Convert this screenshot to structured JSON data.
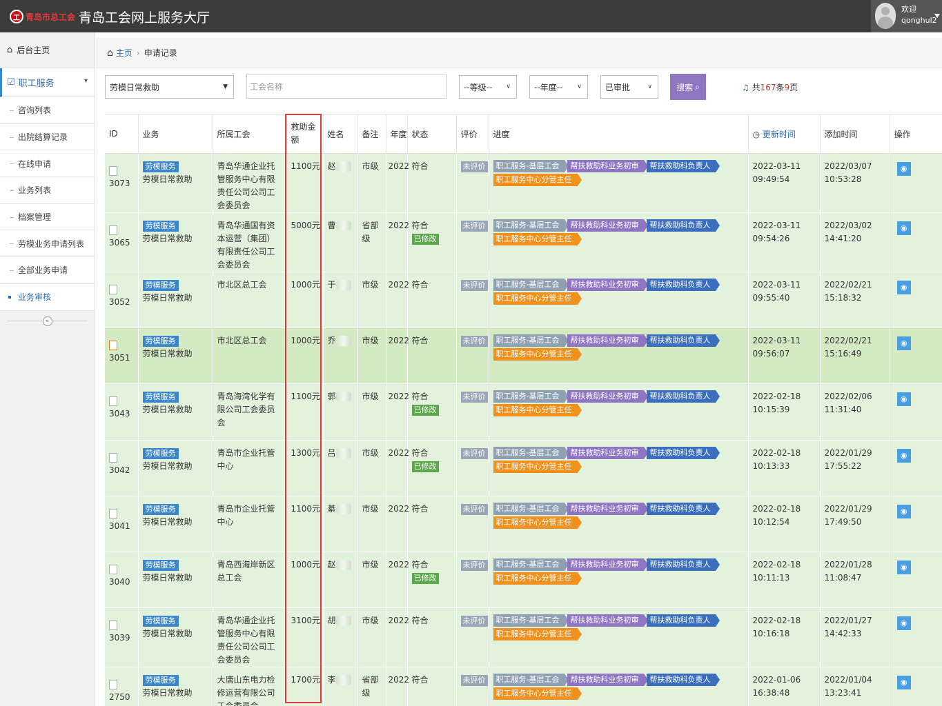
{
  "header": {
    "logo_text": "青岛市总工会",
    "title": "青岛工会网上服务大厅",
    "welcome": "欢迎",
    "username": "qonghul2"
  },
  "sidebar": {
    "home": "后台主页",
    "service": "职工服务",
    "items": [
      "咨询列表",
      "出院结算记录",
      "在线申请",
      "业务列表",
      "档案管理",
      "劳模业务申请列表",
      "全部业务申请",
      "业务审核"
    ]
  },
  "breadcrumb": {
    "home": "主页",
    "current": "申请记录"
  },
  "filters": {
    "business_type": "劳模日常救助",
    "union_placeholder": "工会名称",
    "level": "--等级--",
    "year": "--年度--",
    "status": "已审批",
    "search_label": "搜索",
    "total_prefix": "共",
    "total_count": "167",
    "total_mid": "条",
    "total_pages": "9",
    "total_suffix": "页"
  },
  "table": {
    "headers": {
      "id": "ID",
      "business": "业务",
      "union": "所属工会",
      "amount": "救助金额",
      "name": "姓名",
      "remark": "备注",
      "year": "年度",
      "status": "状态",
      "eval": "评价",
      "progress": "进度",
      "updated": "更新时间",
      "added": "添加时间",
      "action": "操作"
    },
    "tag_label": "劳模服务",
    "business_label": "劳模日常救助",
    "eval_label": "未评价",
    "modified_label": "已修改",
    "steps": [
      "职工服务-基层工会",
      "帮扶救助科业务初审",
      "帮扶救助科负责人",
      "职工服务中心分管主任"
    ],
    "rows": [
      {
        "id": "3073",
        "union": "青岛华通企业托管服务中心有限责任公司公司工会委员会",
        "amount": "1100元",
        "name": "赵",
        "remark": "市级",
        "year": "2022",
        "status": "符合",
        "modified": false,
        "updated_date": "2022-03-11",
        "updated_time": "09:49:54",
        "added_date": "2022/03/07",
        "added_time": "10:53:28"
      },
      {
        "id": "3065",
        "union": "青岛华通国有资本运营（集团）有限责任公司工会委员会",
        "amount": "5000元",
        "name": "曹",
        "remark": "省部级",
        "year": "2022",
        "status": "符合",
        "modified": true,
        "updated_date": "2022-03-11",
        "updated_time": "09:54:26",
        "added_date": "2022/03/02",
        "added_time": "14:41:20"
      },
      {
        "id": "3052",
        "union": "市北区总工会",
        "amount": "1000元",
        "name": "于",
        "remark": "市级",
        "year": "2022",
        "status": "符合",
        "modified": false,
        "updated_date": "2022-03-11",
        "updated_time": "09:55:40",
        "added_date": "2022/02/21",
        "added_time": "15:18:32"
      },
      {
        "id": "3051",
        "union": "市北区总工会",
        "amount": "1000元",
        "name": "乔",
        "remark": "市级",
        "year": "2022",
        "status": "符合",
        "modified": false,
        "updated_date": "2022-03-11",
        "updated_time": "09:56:07",
        "added_date": "2022/02/21",
        "added_time": "15:16:49"
      },
      {
        "id": "3043",
        "union": "青岛海湾化学有限公司工会委员会",
        "amount": "1100元",
        "name": "郭",
        "remark": "市级",
        "year": "2022",
        "status": "符合",
        "modified": true,
        "updated_date": "2022-02-18",
        "updated_time": "10:15:39",
        "added_date": "2022/02/06",
        "added_time": "11:31:40"
      },
      {
        "id": "3042",
        "union": "青岛市企业托管中心",
        "amount": "1300元",
        "name": "吕",
        "remark": "市级",
        "year": "2022",
        "status": "符合",
        "modified": true,
        "updated_date": "2022-02-18",
        "updated_time": "10:13:33",
        "added_date": "2022/01/29",
        "added_time": "17:55:22"
      },
      {
        "id": "3041",
        "union": "青岛市企业托管中心",
        "amount": "1100元",
        "name": "綦",
        "remark": "市级",
        "year": "2022",
        "status": "符合",
        "modified": false,
        "updated_date": "2022-02-18",
        "updated_time": "10:12:54",
        "added_date": "2022/01/29",
        "added_time": "17:49:50"
      },
      {
        "id": "3040",
        "union": "青岛西海岸新区总工会",
        "amount": "1000元",
        "name": "赵",
        "remark": "市级",
        "year": "2022",
        "status": "符合",
        "modified": true,
        "updated_date": "2022-02-18",
        "updated_time": "10:11:13",
        "added_date": "2022/01/28",
        "added_time": "11:08:47"
      },
      {
        "id": "3039",
        "union": "青岛华通企业托管服务中心有限责任公司公司工会委员会",
        "amount": "3100元",
        "name": "胡",
        "remark": "市级",
        "year": "2022",
        "status": "符合",
        "modified": false,
        "updated_date": "2022-02-18",
        "updated_time": "10:16:18",
        "added_date": "2022/01/27",
        "added_time": "14:42:33"
      },
      {
        "id": "2750",
        "union": "大唐山东电力检修运营有限公司工会委员会",
        "amount": "1700元",
        "name": "李",
        "remark": "省部级",
        "year": "2022",
        "status": "符合",
        "modified": false,
        "updated_date": "2022-01-06",
        "updated_time": "16:38:48",
        "added_date": "2022/01/04",
        "added_time": "13:23:41"
      }
    ]
  }
}
